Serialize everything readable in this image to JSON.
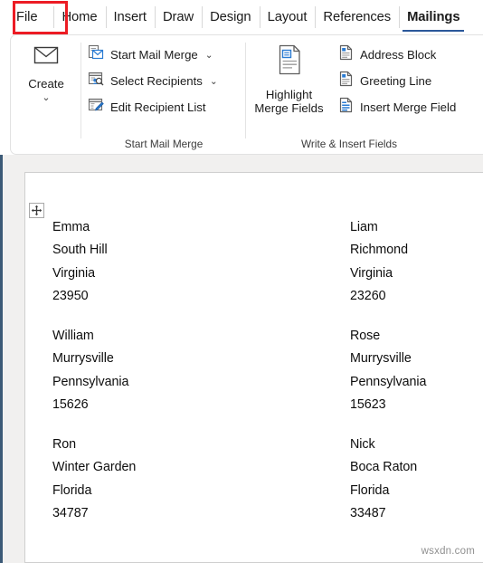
{
  "ribbon_tabs": [
    {
      "label": "File",
      "active": false,
      "highlighted": true
    },
    {
      "label": "Home",
      "active": false,
      "highlighted": false
    },
    {
      "label": "Insert",
      "active": false,
      "highlighted": false
    },
    {
      "label": "Draw",
      "active": false,
      "highlighted": false
    },
    {
      "label": "Design",
      "active": false,
      "highlighted": false
    },
    {
      "label": "Layout",
      "active": false,
      "highlighted": false
    },
    {
      "label": "References",
      "active": false,
      "highlighted": false
    },
    {
      "label": "Mailings",
      "active": true,
      "highlighted": false
    }
  ],
  "ribbon": {
    "groups": [
      {
        "name": "create",
        "label": "",
        "big_button": {
          "label": "Create",
          "icon": "envelope-icon",
          "has_dropdown": true,
          "dropdown_glyph": "⌄"
        }
      },
      {
        "name": "start-mail-merge",
        "label": "Start Mail Merge",
        "items": [
          {
            "label": "Start Mail Merge",
            "icon": "mail-merge-icon",
            "has_dropdown": true,
            "dropdown_glyph": "⌄"
          },
          {
            "label": "Select Recipients",
            "icon": "select-recipients-icon",
            "has_dropdown": true,
            "dropdown_glyph": "⌄"
          },
          {
            "label": "Edit Recipient List",
            "icon": "edit-recipient-list-icon",
            "has_dropdown": false,
            "dropdown_glyph": ""
          }
        ]
      },
      {
        "name": "write-insert-fields",
        "label": "Write & Insert Fields",
        "big_button": {
          "label": "Highlight\nMerge Fields",
          "label_line1": "Highlight",
          "label_line2": "Merge Fields",
          "icon": "highlight-merge-fields-icon",
          "has_dropdown": false,
          "dropdown_glyph": ""
        },
        "items": [
          {
            "label": "Address Block",
            "icon": "address-block-icon",
            "has_dropdown": false,
            "dropdown_glyph": ""
          },
          {
            "label": "Greeting Line",
            "icon": "greeting-line-icon",
            "has_dropdown": false,
            "dropdown_glyph": ""
          },
          {
            "label": "Insert Merge Field",
            "icon": "insert-merge-field-icon",
            "has_dropdown": false,
            "dropdown_glyph": ""
          }
        ]
      }
    ]
  },
  "document": {
    "table_handle_icon": "move-handle-icon",
    "addresses": [
      {
        "name": "Emma",
        "city": "South Hill",
        "state": "Virginia",
        "zip": "23950"
      },
      {
        "name": "Liam",
        "city": "Richmond",
        "state": "Virginia",
        "zip": "23260"
      },
      {
        "name": "William",
        "city": "Murrysville",
        "state": "Pennsylvania",
        "zip": "15626"
      },
      {
        "name": "Rose",
        "city": "Murrysville",
        "state": "Pennsylvania",
        "zip": "15623"
      },
      {
        "name": "Ron",
        "city": "Winter Garden",
        "state": "Florida",
        "zip": "34787"
      },
      {
        "name": "Nick",
        "city": "Boca Raton",
        "state": "Florida",
        "zip": "33487"
      }
    ],
    "watermark": "wsxdn.com"
  },
  "colors": {
    "accent_blue": "#2b579a",
    "highlight_red": "#ec1c24",
    "icon_blue": "#2b7cd3",
    "canvas_gray": "#f1f0ef",
    "rail_blue": "#3c5a77"
  }
}
